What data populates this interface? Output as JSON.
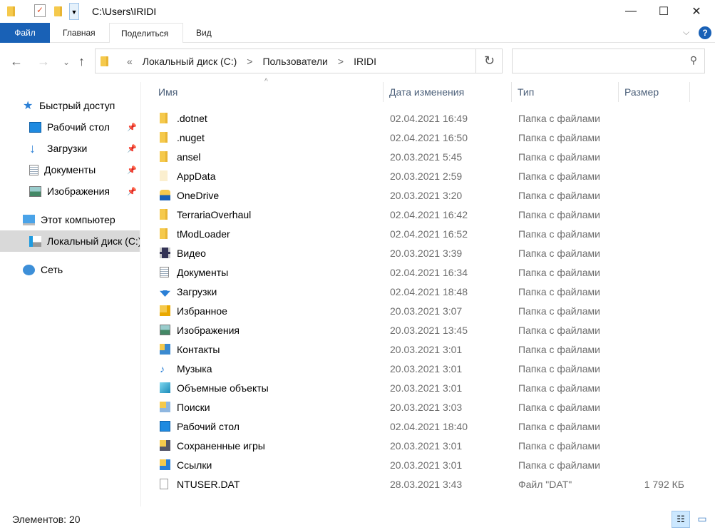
{
  "window": {
    "title": "C:\\Users\\IRIDI",
    "minimize": "—",
    "maximize": "☐",
    "close": "✕"
  },
  "ribbon": {
    "tabs": [
      "Файл",
      "Главная",
      "Поделиться",
      "Вид"
    ]
  },
  "address": {
    "prefix": "«",
    "crumbs": [
      "Локальный диск (C:)",
      "Пользователи",
      "IRIDI"
    ],
    "separator": ">",
    "search_placeholder": ""
  },
  "sidebar": {
    "items": [
      {
        "label": "Быстрый доступ",
        "icon": "star-icon"
      },
      {
        "label": "Рабочий стол",
        "icon": "desktop-icon",
        "pinned": true
      },
      {
        "label": "Загрузки",
        "icon": "download-icon",
        "pinned": true
      },
      {
        "label": "Документы",
        "icon": "documents-icon",
        "pinned": true
      },
      {
        "label": "Изображения",
        "icon": "pictures-icon",
        "pinned": true
      },
      {
        "label": "Этот компьютер",
        "icon": "computer-icon"
      },
      {
        "label": "Локальный диск (C:)",
        "icon": "drive-icon",
        "selected": true
      },
      {
        "label": "Сеть",
        "icon": "network-icon"
      }
    ]
  },
  "columns": {
    "name": "Имя",
    "date": "Дата изменения",
    "type": "Тип",
    "size": "Размер"
  },
  "files": [
    {
      "name": ".dotnet",
      "date": "02.04.2021 16:49",
      "type": "Папка с файлами",
      "size": "",
      "icon": "folder-icon"
    },
    {
      "name": ".nuget",
      "date": "02.04.2021 16:50",
      "type": "Папка с файлами",
      "size": "",
      "icon": "folder-icon"
    },
    {
      "name": "ansel",
      "date": "20.03.2021 5:45",
      "type": "Папка с файлами",
      "size": "",
      "icon": "folder-icon"
    },
    {
      "name": "AppData",
      "date": "20.03.2021 2:59",
      "type": "Папка с файлами",
      "size": "",
      "icon": "hidden-folder-icon"
    },
    {
      "name": "OneDrive",
      "date": "20.03.2021 3:20",
      "type": "Папка с файлами",
      "size": "",
      "icon": "onedrive-icon"
    },
    {
      "name": "TerrariaOverhaul",
      "date": "02.04.2021 16:42",
      "type": "Папка с файлами",
      "size": "",
      "icon": "folder-icon"
    },
    {
      "name": "tModLoader",
      "date": "02.04.2021 16:52",
      "type": "Папка с файлами",
      "size": "",
      "icon": "folder-icon"
    },
    {
      "name": "Видео",
      "date": "20.03.2021 3:39",
      "type": "Папка с файлами",
      "size": "",
      "icon": "video-icon"
    },
    {
      "name": "Документы",
      "date": "02.04.2021 16:34",
      "type": "Папка с файлами",
      "size": "",
      "icon": "documents-icon"
    },
    {
      "name": "Загрузки",
      "date": "02.04.2021 18:48",
      "type": "Папка с файлами",
      "size": "",
      "icon": "download-icon"
    },
    {
      "name": "Избранное",
      "date": "20.03.2021 3:07",
      "type": "Папка с файлами",
      "size": "",
      "icon": "favorites-icon"
    },
    {
      "name": "Изображения",
      "date": "20.03.2021 13:45",
      "type": "Папка с файлами",
      "size": "",
      "icon": "pictures-icon"
    },
    {
      "name": "Контакты",
      "date": "20.03.2021 3:01",
      "type": "Папка с файлами",
      "size": "",
      "icon": "contacts-icon"
    },
    {
      "name": "Музыка",
      "date": "20.03.2021 3:01",
      "type": "Папка с файлами",
      "size": "",
      "icon": "music-icon"
    },
    {
      "name": "Объемные объекты",
      "date": "20.03.2021 3:01",
      "type": "Папка с файлами",
      "size": "",
      "icon": "3d-objects-icon"
    },
    {
      "name": "Поиски",
      "date": "20.03.2021 3:03",
      "type": "Папка с файлами",
      "size": "",
      "icon": "searches-icon"
    },
    {
      "name": "Рабочий стол",
      "date": "02.04.2021 18:40",
      "type": "Папка с файлами",
      "size": "",
      "icon": "desktop-icon"
    },
    {
      "name": "Сохраненные игры",
      "date": "20.03.2021 3:01",
      "type": "Папка с файлами",
      "size": "",
      "icon": "saved-games-icon"
    },
    {
      "name": "Ссылки",
      "date": "20.03.2021 3:01",
      "type": "Папка с файлами",
      "size": "",
      "icon": "links-icon"
    },
    {
      "name": "NTUSER.DAT",
      "date": "28.03.2021 3:43",
      "type": "Файл \"DAT\"",
      "size": "1 792 КБ",
      "icon": "file-icon"
    }
  ],
  "status": {
    "count": "Элементов: 20"
  },
  "colors": {
    "accent": "#1961b6",
    "folder": "#f5c94c"
  }
}
